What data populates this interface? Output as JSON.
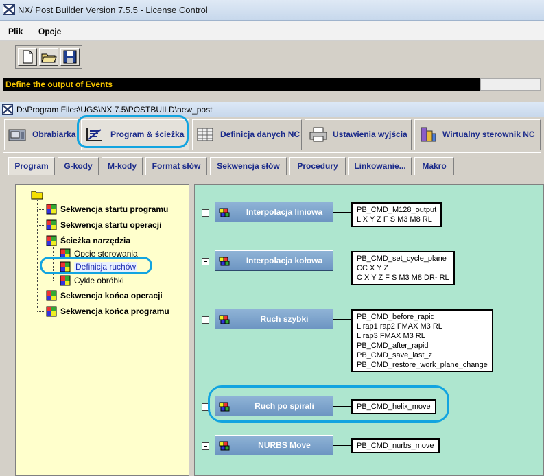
{
  "window": {
    "title": "NX/ Post Builder Version 7.5.5 - License Control"
  },
  "menu": {
    "items": [
      "Plik",
      "Opcje"
    ]
  },
  "status": {
    "text": "Define the output of Events"
  },
  "inner_window": {
    "path": "D:\\Program Files\\UGS\\NX 7.5\\POSTBUILD\\new_post"
  },
  "main_tabs": [
    {
      "label": "Obrabiarka"
    },
    {
      "label": "Program & ścieżka"
    },
    {
      "label": "Definicja danych NC"
    },
    {
      "label": "Ustawienia wyjścia"
    },
    {
      "label": "Wirtualny sterownik NC"
    }
  ],
  "sub_tabs": [
    {
      "label": "Program"
    },
    {
      "label": "G-kody"
    },
    {
      "label": "M-kody"
    },
    {
      "label": "Format słów"
    },
    {
      "label": "Sekwencja słów"
    },
    {
      "label": "Procedury"
    },
    {
      "label": "Linkowanie..."
    },
    {
      "label": "Makro"
    }
  ],
  "tree": [
    {
      "label": "Sekwencja startu programu"
    },
    {
      "label": "Sekwencja startu operacji"
    },
    {
      "label": "Ścieżka narzędzia"
    },
    {
      "label": "Opcje sterowania"
    },
    {
      "label": "Definicja ruchów"
    },
    {
      "label": "Cykle obróbki"
    },
    {
      "label": "Sekwencja końca operacji"
    },
    {
      "label": "Sekwencja końca programu"
    }
  ],
  "events": [
    {
      "label": "Interpolacja liniowa",
      "commands": [
        "PB_CMD_M128_output",
        "L X Y Z F S M3 M8 RL"
      ]
    },
    {
      "label": "Interpolacja kołowa",
      "commands": [
        "PB_CMD_set_cycle_plane",
        "CC X Y Z",
        "C X Y Z F S M3 M8 DR- RL"
      ]
    },
    {
      "label": "Ruch szybki",
      "commands": [
        "PB_CMD_before_rapid",
        "L rap1 rap2 FMAX M3 RL",
        "L rap3 FMAX M3 RL",
        "PB_CMD_after_rapid",
        "PB_CMD_save_last_z",
        "PB_CMD_restore_work_plane_change"
      ]
    },
    {
      "label": "Ruch po spirali",
      "commands": [
        "PB_CMD_helix_move"
      ]
    },
    {
      "label": "NURBS Move",
      "commands": [
        "PB_CMD_nurbs_move"
      ]
    }
  ]
}
